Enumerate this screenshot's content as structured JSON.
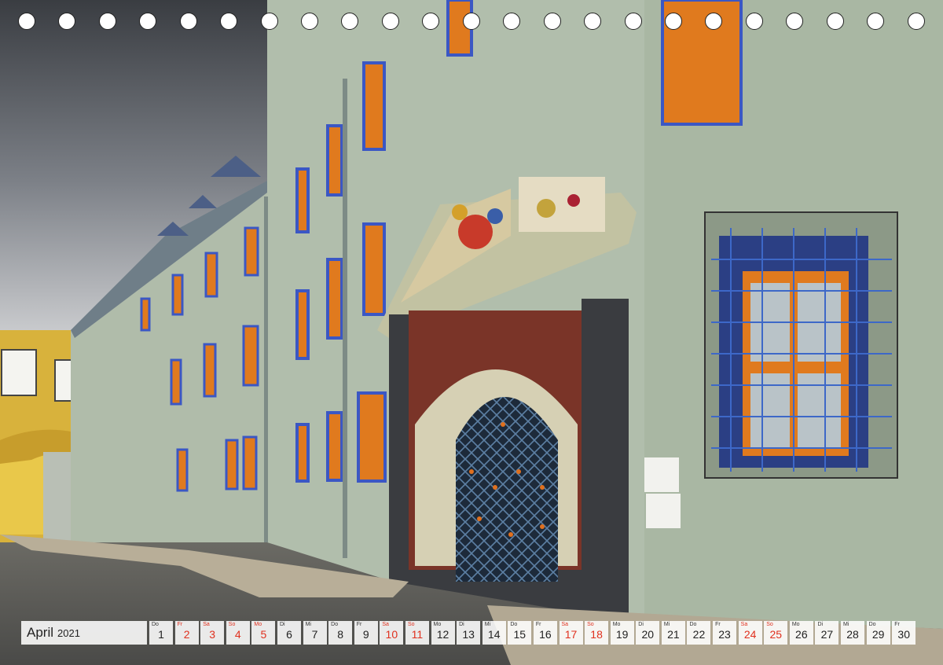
{
  "calendar": {
    "month": "April",
    "year": "2021",
    "days": [
      {
        "wd": "Do",
        "num": "1",
        "red": false
      },
      {
        "wd": "Fr",
        "num": "2",
        "red": true
      },
      {
        "wd": "Sa",
        "num": "3",
        "red": true
      },
      {
        "wd": "So",
        "num": "4",
        "red": true
      },
      {
        "wd": "Mo",
        "num": "5",
        "red": true
      },
      {
        "wd": "Di",
        "num": "6",
        "red": false
      },
      {
        "wd": "Mi",
        "num": "7",
        "red": false
      },
      {
        "wd": "Do",
        "num": "8",
        "red": false
      },
      {
        "wd": "Fr",
        "num": "9",
        "red": false
      },
      {
        "wd": "Sa",
        "num": "10",
        "red": true
      },
      {
        "wd": "So",
        "num": "11",
        "red": true
      },
      {
        "wd": "Mo",
        "num": "12",
        "red": false
      },
      {
        "wd": "Di",
        "num": "13",
        "red": false
      },
      {
        "wd": "Mi",
        "num": "14",
        "red": false
      },
      {
        "wd": "Do",
        "num": "15",
        "red": false
      },
      {
        "wd": "Fr",
        "num": "16",
        "red": false
      },
      {
        "wd": "Sa",
        "num": "17",
        "red": true
      },
      {
        "wd": "So",
        "num": "18",
        "red": true
      },
      {
        "wd": "Mo",
        "num": "19",
        "red": false
      },
      {
        "wd": "Di",
        "num": "20",
        "red": false
      },
      {
        "wd": "Mi",
        "num": "21",
        "red": false
      },
      {
        "wd": "Do",
        "num": "22",
        "red": false
      },
      {
        "wd": "Fr",
        "num": "23",
        "red": false
      },
      {
        "wd": "Sa",
        "num": "24",
        "red": true
      },
      {
        "wd": "So",
        "num": "25",
        "red": true
      },
      {
        "wd": "Mo",
        "num": "26",
        "red": false
      },
      {
        "wd": "Di",
        "num": "27",
        "red": false
      },
      {
        "wd": "Mi",
        "num": "28",
        "red": false
      },
      {
        "wd": "Do",
        "num": "29",
        "red": false
      },
      {
        "wd": "Fr",
        "num": "30",
        "red": false
      }
    ]
  },
  "colors": {
    "holiday": "#e0301e",
    "facade": "#a9b7a3",
    "bridge": "#d8b23c",
    "gate_red": "#7a3428",
    "window_frame": "#e07a1e",
    "shutter_blue": "#3b57c4"
  }
}
